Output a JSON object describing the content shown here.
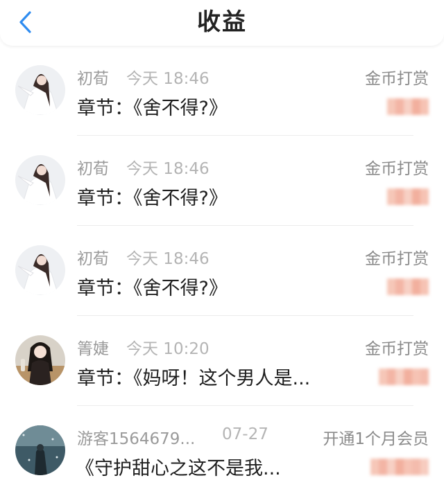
{
  "header": {
    "title": "收益",
    "back_icon": "chevron-left-icon"
  },
  "colors": {
    "accent": "#2f8cf0",
    "title_text": "#222222",
    "meta_text": "#9a9a9a",
    "divider": "#ececec",
    "blurred_amount": "#f4b8a8"
  },
  "earnings": [
    {
      "name": "初荀",
      "time": "今天 18:46",
      "type": "金币打赏",
      "desc": "章节：《舍不得?》"
    },
    {
      "name": "初荀",
      "time": "今天 18:46",
      "type": "金币打赏",
      "desc": "章节：《舍不得?》"
    },
    {
      "name": "初荀",
      "time": "今天 18:46",
      "type": "金币打赏",
      "desc": "章节：《舍不得?》"
    },
    {
      "name": "箐婕",
      "time": "今天 10:20",
      "type": "金币打赏",
      "desc": "章节：《妈呀！这个男人是..."
    },
    {
      "name": "游客1564679...",
      "time": "07-27",
      "type": "开通1个月会员",
      "desc": "《守护甜心之这不是我..."
    }
  ]
}
